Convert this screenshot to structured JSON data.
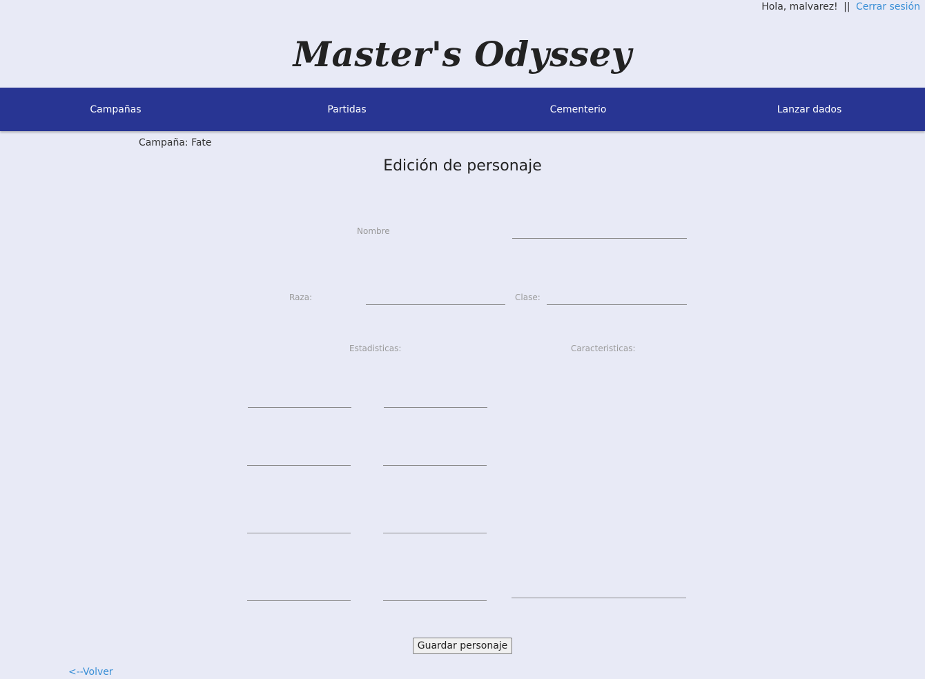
{
  "header": {
    "greeting": "Hola, malvarez!",
    "separator": "||",
    "logout_label": "Cerrar sesión",
    "site_title": "Master's Odyssey"
  },
  "nav": {
    "items": [
      {
        "label": "Campañas"
      },
      {
        "label": "Partidas"
      },
      {
        "label": "Cementerio"
      },
      {
        "label": "Lanzar dados"
      }
    ]
  },
  "main": {
    "campaign_label": "Campaña: Fate",
    "heading": "Edición de personaje",
    "form": {
      "name_label": "Nombre",
      "name_value": "",
      "race_label": "Raza:",
      "race_value": "",
      "class_label": "Clase:",
      "class_value": "",
      "stats_label": "Estadisticas:",
      "traits_label": "Caracteristicas:",
      "stats_values": [
        "",
        "",
        "",
        "",
        "",
        "",
        "",
        ""
      ],
      "traits_value": "",
      "save_label": "Guardar personaje"
    },
    "back_label": "<--Volver"
  },
  "colors": {
    "background": "#e8eaf6",
    "navbar": "#283593",
    "link": "#3a8fd6"
  }
}
